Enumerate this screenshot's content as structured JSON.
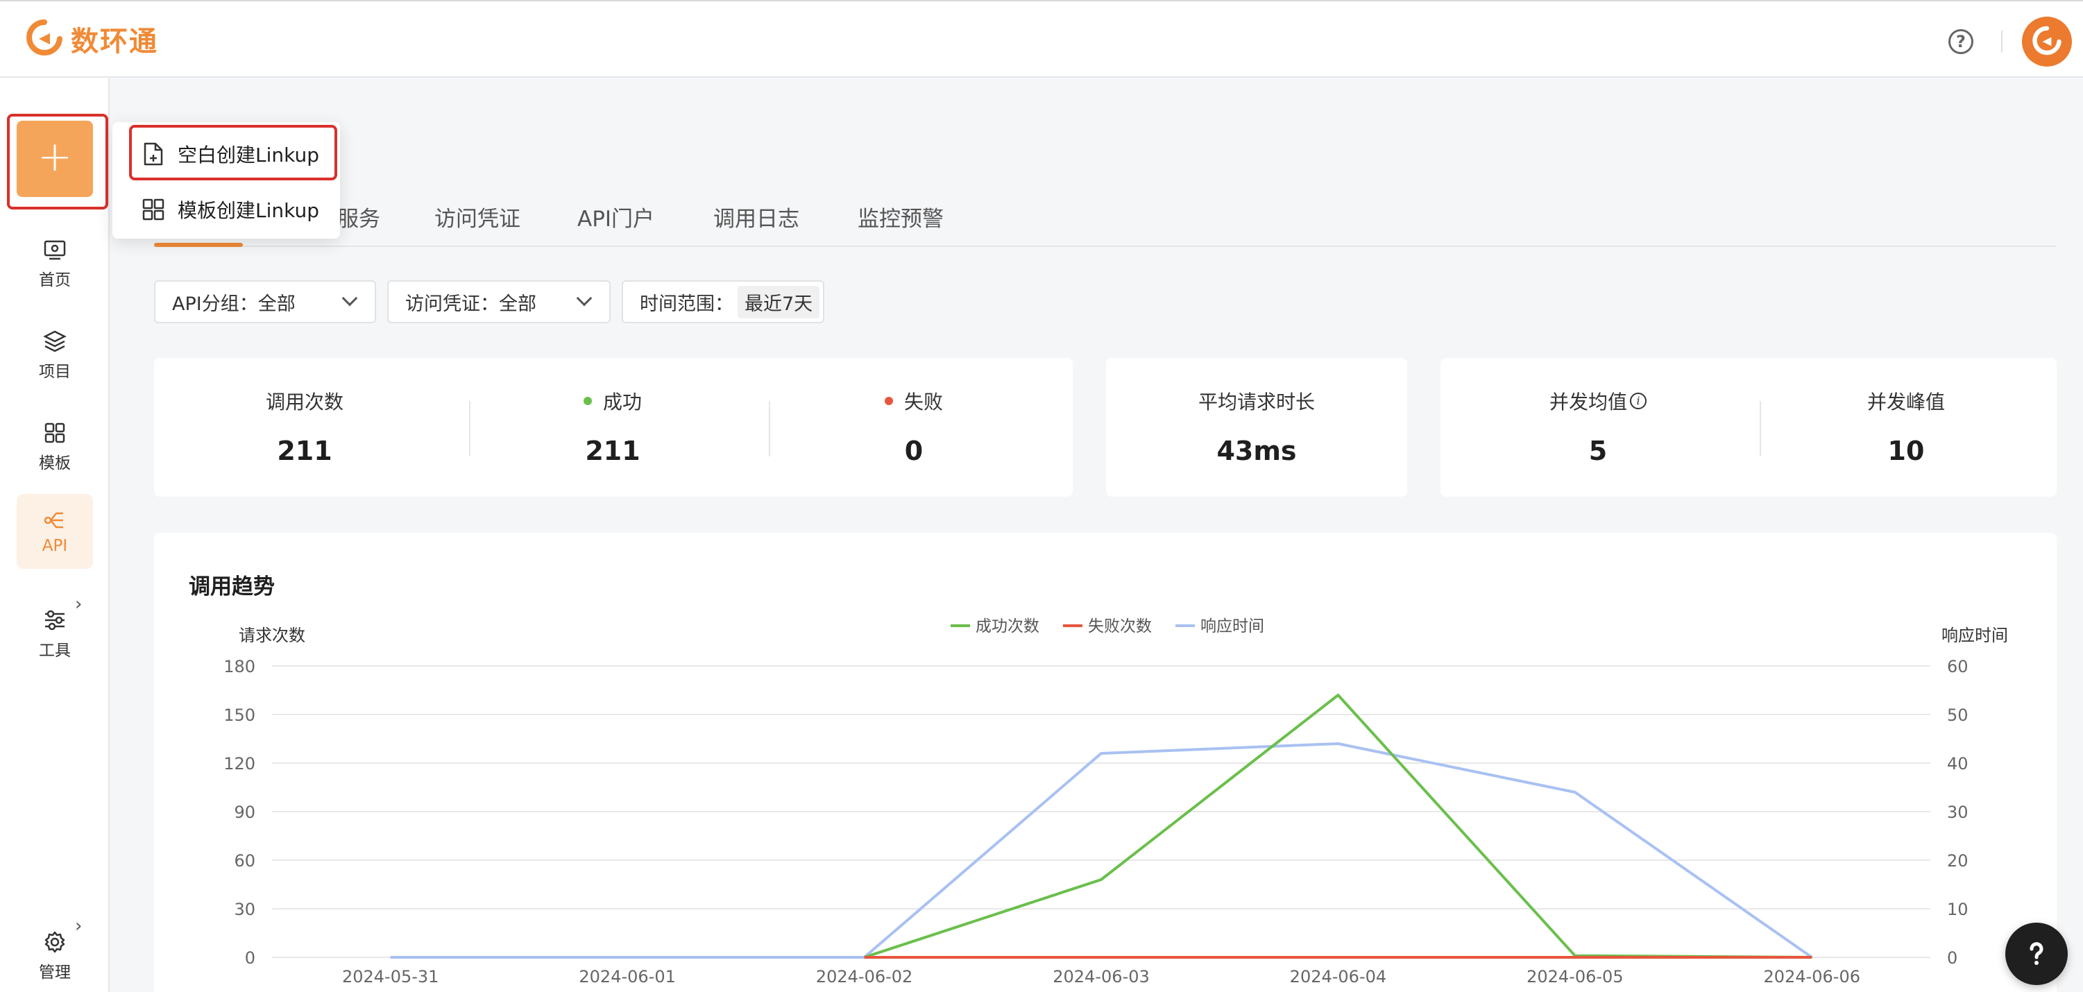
{
  "app": {
    "name": "数环通"
  },
  "sidebar": {
    "items": [
      {
        "label": "首页",
        "icon": "monitor-icon"
      },
      {
        "label": "项目",
        "icon": "layers-icon"
      },
      {
        "label": "模板",
        "icon": "grid-icon"
      },
      {
        "label": "API",
        "icon": "api-icon",
        "active": true
      },
      {
        "label": "工具",
        "icon": "sliders-icon"
      },
      {
        "label": "管理",
        "icon": "gear-icon"
      }
    ]
  },
  "create_menu": {
    "items": [
      {
        "label": "空白创建Linkup",
        "icon": "new-file-icon"
      },
      {
        "label": "模板创建Linkup",
        "icon": "template-grid-icon"
      }
    ]
  },
  "tabs": [
    {
      "label": "服务"
    },
    {
      "label": "访问凭证"
    },
    {
      "label": "API门户"
    },
    {
      "label": "调用日志"
    },
    {
      "label": "监控预警"
    }
  ],
  "filters": {
    "api_group": "API分组：全部",
    "credential": "访问凭证：全部",
    "time_range_label": "时间范围：",
    "time_range_value": "最近7天"
  },
  "stats": {
    "calls_label": "调用次数",
    "calls_value": "211",
    "success_label": "成功",
    "success_value": "211",
    "fail_label": "失败",
    "fail_value": "0",
    "avg_label": "平均请求时长",
    "avg_value": "43ms",
    "concurrency_avg_label": "并发均值",
    "concurrency_avg_value": "5",
    "concurrency_peak_label": "并发峰值",
    "concurrency_peak_value": "10"
  },
  "colors": {
    "accent": "#f08a36",
    "success": "#6abf4b",
    "fail": "#e8553e",
    "response": "#a9c1f2"
  },
  "chart_data": {
    "type": "line",
    "title": "调用趋势",
    "ylabel": "请求次数",
    "y2label": "响应时间",
    "categories": [
      "2024-05-31",
      "2024-06-01",
      "2024-06-02",
      "2024-06-03",
      "2024-06-04",
      "2024-06-05",
      "2024-06-06"
    ],
    "ylim": [
      0,
      180
    ],
    "y2lim": [
      0,
      60
    ],
    "yticks": [
      0,
      30,
      60,
      90,
      120,
      150,
      180
    ],
    "y2ticks": [
      0,
      10,
      20,
      30,
      40,
      50,
      60
    ],
    "legend_position": "top-center",
    "grid": true,
    "series": [
      {
        "name": "成功次数",
        "axis": "left",
        "color": "#6abf4b",
        "values": [
          null,
          null,
          0,
          48,
          162,
          1,
          0
        ]
      },
      {
        "name": "失败次数",
        "axis": "left",
        "color": "#e8553e",
        "values": [
          null,
          null,
          0,
          0,
          0,
          0,
          0
        ]
      },
      {
        "name": "响应时间",
        "axis": "right",
        "color": "#a9c1f2",
        "values": [
          0,
          0,
          0,
          42,
          44,
          34,
          0
        ]
      }
    ]
  }
}
